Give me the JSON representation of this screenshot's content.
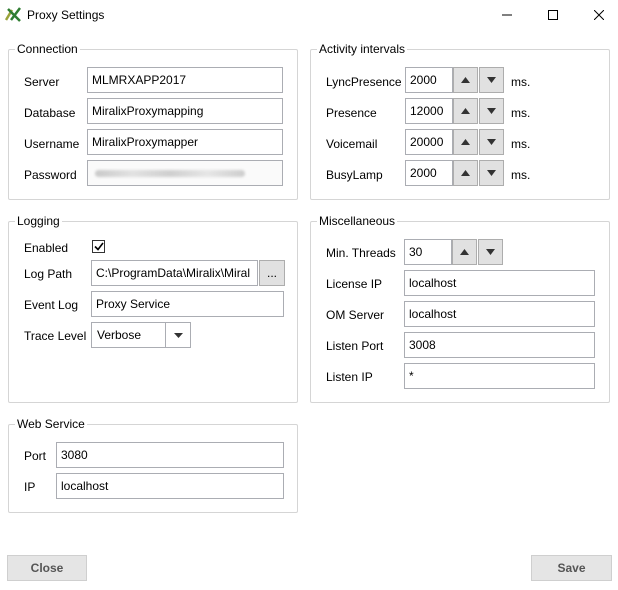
{
  "window": {
    "title": "Proxy Settings"
  },
  "connection": {
    "title": "Connection",
    "server_label": "Server",
    "server_value": "MLMRXAPP2017",
    "database_label": "Database",
    "database_value": "MiralixProxymapping",
    "username_label": "Username",
    "username_value": "MiralixProxymapper",
    "password_label": "Password"
  },
  "activity": {
    "title": "Activity intervals",
    "unit": "ms.",
    "rows": [
      {
        "label": "LyncPresence",
        "value": "2000"
      },
      {
        "label": "Presence",
        "value": "12000"
      },
      {
        "label": "Voicemail",
        "value": "20000"
      },
      {
        "label": "BusyLamp",
        "value": "2000"
      }
    ]
  },
  "logging": {
    "title": "Logging",
    "enabled_label": "Enabled",
    "enabled": true,
    "log_path_label": "Log Path",
    "log_path_value": "C:\\ProgramData\\Miralix\\Miral",
    "browse_label": "...",
    "event_log_label": "Event Log",
    "event_log_value": "Proxy Service",
    "trace_level_label": "Trace Level",
    "trace_level_value": "Verbose"
  },
  "misc": {
    "title": "Miscellaneous",
    "min_threads_label": "Min. Threads",
    "min_threads_value": "30",
    "license_ip_label": "License IP",
    "license_ip_value": "localhost",
    "om_server_label": "OM Server",
    "om_server_value": "localhost",
    "listen_port_label": "Listen Port",
    "listen_port_value": "3008",
    "listen_ip_label": "Listen IP",
    "listen_ip_value": "*"
  },
  "webservice": {
    "title": "Web Service",
    "port_label": "Port",
    "port_value": "3080",
    "ip_label": "IP",
    "ip_value": "localhost"
  },
  "footer": {
    "close_label": "Close",
    "save_label": "Save"
  }
}
